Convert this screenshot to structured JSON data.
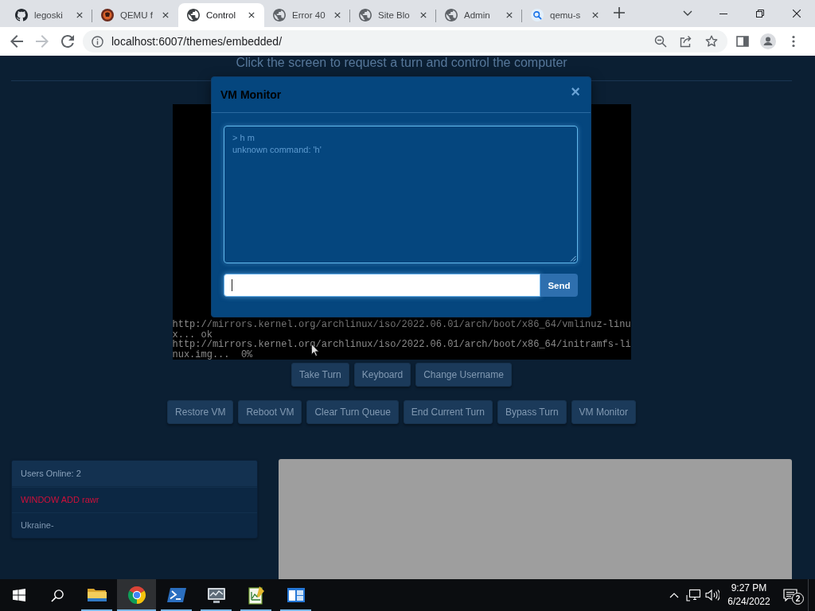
{
  "browser": {
    "tabs": [
      {
        "kind": "github",
        "label": "legoski",
        "selected": false
      },
      {
        "kind": "avatar",
        "label": "QEMU f",
        "selected": false
      },
      {
        "kind": "globe",
        "label": "Control",
        "selected": true
      },
      {
        "kind": "globe",
        "label": "Error 40",
        "selected": false
      },
      {
        "kind": "globe",
        "label": "Site Blo",
        "selected": false
      },
      {
        "kind": "globe",
        "label": "Admin",
        "selected": false
      },
      {
        "kind": "search",
        "label": "qemu-s",
        "selected": false
      }
    ],
    "toolbar": {
      "back_disabled": false,
      "forward_disabled": true,
      "url": "localhost:6007/themes/embedded/"
    }
  },
  "page": {
    "hint": "Click the screen to request a turn and control the computer",
    "vm_screen": {
      "lines": [
        "http://mirrors.kernel.org/archlinux/iso/2022.06.01/arch/boot/x86_64/vmlinuz-linu",
        "x... ok",
        "http://mirrors.kernel.org/archlinux/iso/2022.06.01/arch/boot/x86_64/initramfs-li",
        "nux.img...  0%"
      ]
    },
    "turn_buttons": [
      "Take Turn",
      "Keyboard",
      "Change Username"
    ],
    "admin_buttons": [
      "Restore VM",
      "Reboot VM",
      "Clear Turn Queue",
      "End Current Turn",
      "Bypass Turn",
      "VM Monitor"
    ],
    "users_panel": {
      "title": "Users Online: 2",
      "users": [
        {
          "name": "WINDOW ADD rawr",
          "color": "#d0103a"
        },
        {
          "name": "Ukraine-",
          "color": "#7f97b0"
        }
      ]
    }
  },
  "monitor_dialog": {
    "title": "VM Monitor",
    "close": "×",
    "log": [
      "> h m",
      "unknown command: 'h'"
    ],
    "command": {
      "focused": true
    },
    "send": "Send"
  },
  "taskbar": {
    "apps": [
      {
        "kind": "folder",
        "running": true,
        "selected": false
      },
      {
        "kind": "browser",
        "running": true,
        "selected": true
      },
      {
        "kind": "terminal",
        "running": true,
        "selected": false
      },
      {
        "kind": "monitor",
        "running": true,
        "selected": false
      },
      {
        "kind": "chart",
        "running": true,
        "selected": false
      },
      {
        "kind": "window",
        "running": true,
        "selected": false
      }
    ],
    "clock": {
      "time": "9:27 PM",
      "date": "6/24/2022"
    },
    "notifications": "2"
  }
}
